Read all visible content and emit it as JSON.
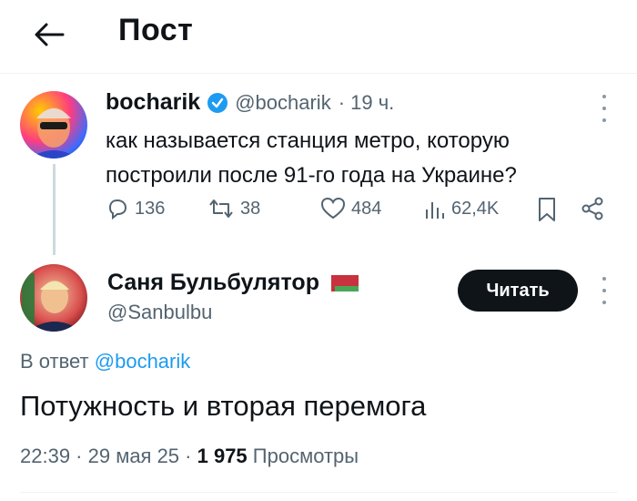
{
  "header": {
    "title": "Пост"
  },
  "original": {
    "name": "bocharik",
    "handle": "@bocharik",
    "time": "· 19 ч.",
    "text": "как называется станция метро, которую построили после 91-го года на Украине?",
    "replies": "136",
    "reposts": "38",
    "likes": "484",
    "views": "62,4K"
  },
  "reply": {
    "name": "Саня Бульбулятор",
    "handle": "@Sanbulbu",
    "follow_label": "Читать",
    "in_reply_prefix": "В ответ",
    "in_reply_mention": "@bocharik",
    "text": "Потужность и вторая перемога",
    "timestamp": "22:39 · 29 мая 25 · ",
    "views_count": "1 975",
    "views_label": " Просмотры"
  },
  "colors": {
    "accent": "#1d9bf0",
    "text": "#0f1419",
    "muted": "#536471",
    "button": "#0f1419"
  },
  "icons": [
    "back-arrow-icon",
    "verified-badge-icon",
    "more-icon",
    "reply-icon",
    "repost-icon",
    "like-icon",
    "views-icon",
    "bookmark-icon",
    "share-icon",
    "belarus-flag-icon"
  ]
}
